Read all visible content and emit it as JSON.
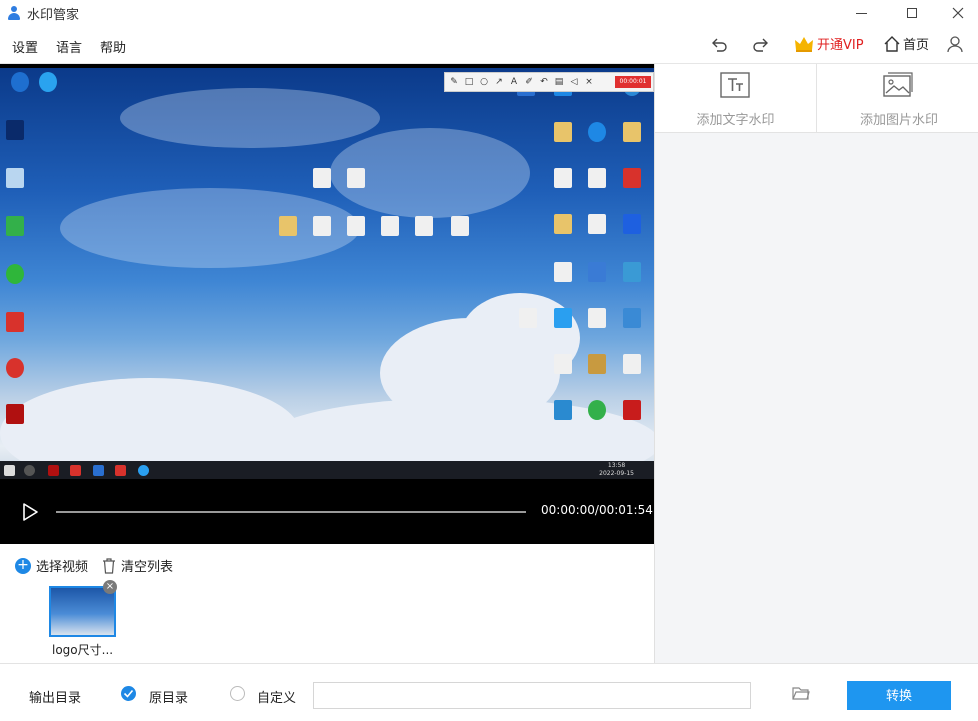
{
  "window": {
    "title": "水印管家"
  },
  "menu": {
    "items": [
      "设置",
      "语言",
      "帮助"
    ]
  },
  "toolbar": {
    "vip_label": "开通VIP",
    "home_label": "首页"
  },
  "video": {
    "time": "00:00:00/00:01:54",
    "desktop_clock": "13:58",
    "desktop_date": "2022-09-15",
    "record_badge": "00:00:01"
  },
  "right_panel": {
    "text_watermark": "添加文字水印",
    "image_watermark": "添加图片水印"
  },
  "file_list": {
    "add_label": "选择视频",
    "clear_label": "清空列表",
    "items": [
      {
        "name": "logo尺寸..."
      }
    ]
  },
  "bottom": {
    "output_label": "输出目录",
    "option_original": "原目录",
    "option_custom": "自定义",
    "path_value": "",
    "convert_label": "转换"
  },
  "colors": {
    "accent": "#1e88e5",
    "vip": "#e02020",
    "convert": "#1e96f0"
  }
}
